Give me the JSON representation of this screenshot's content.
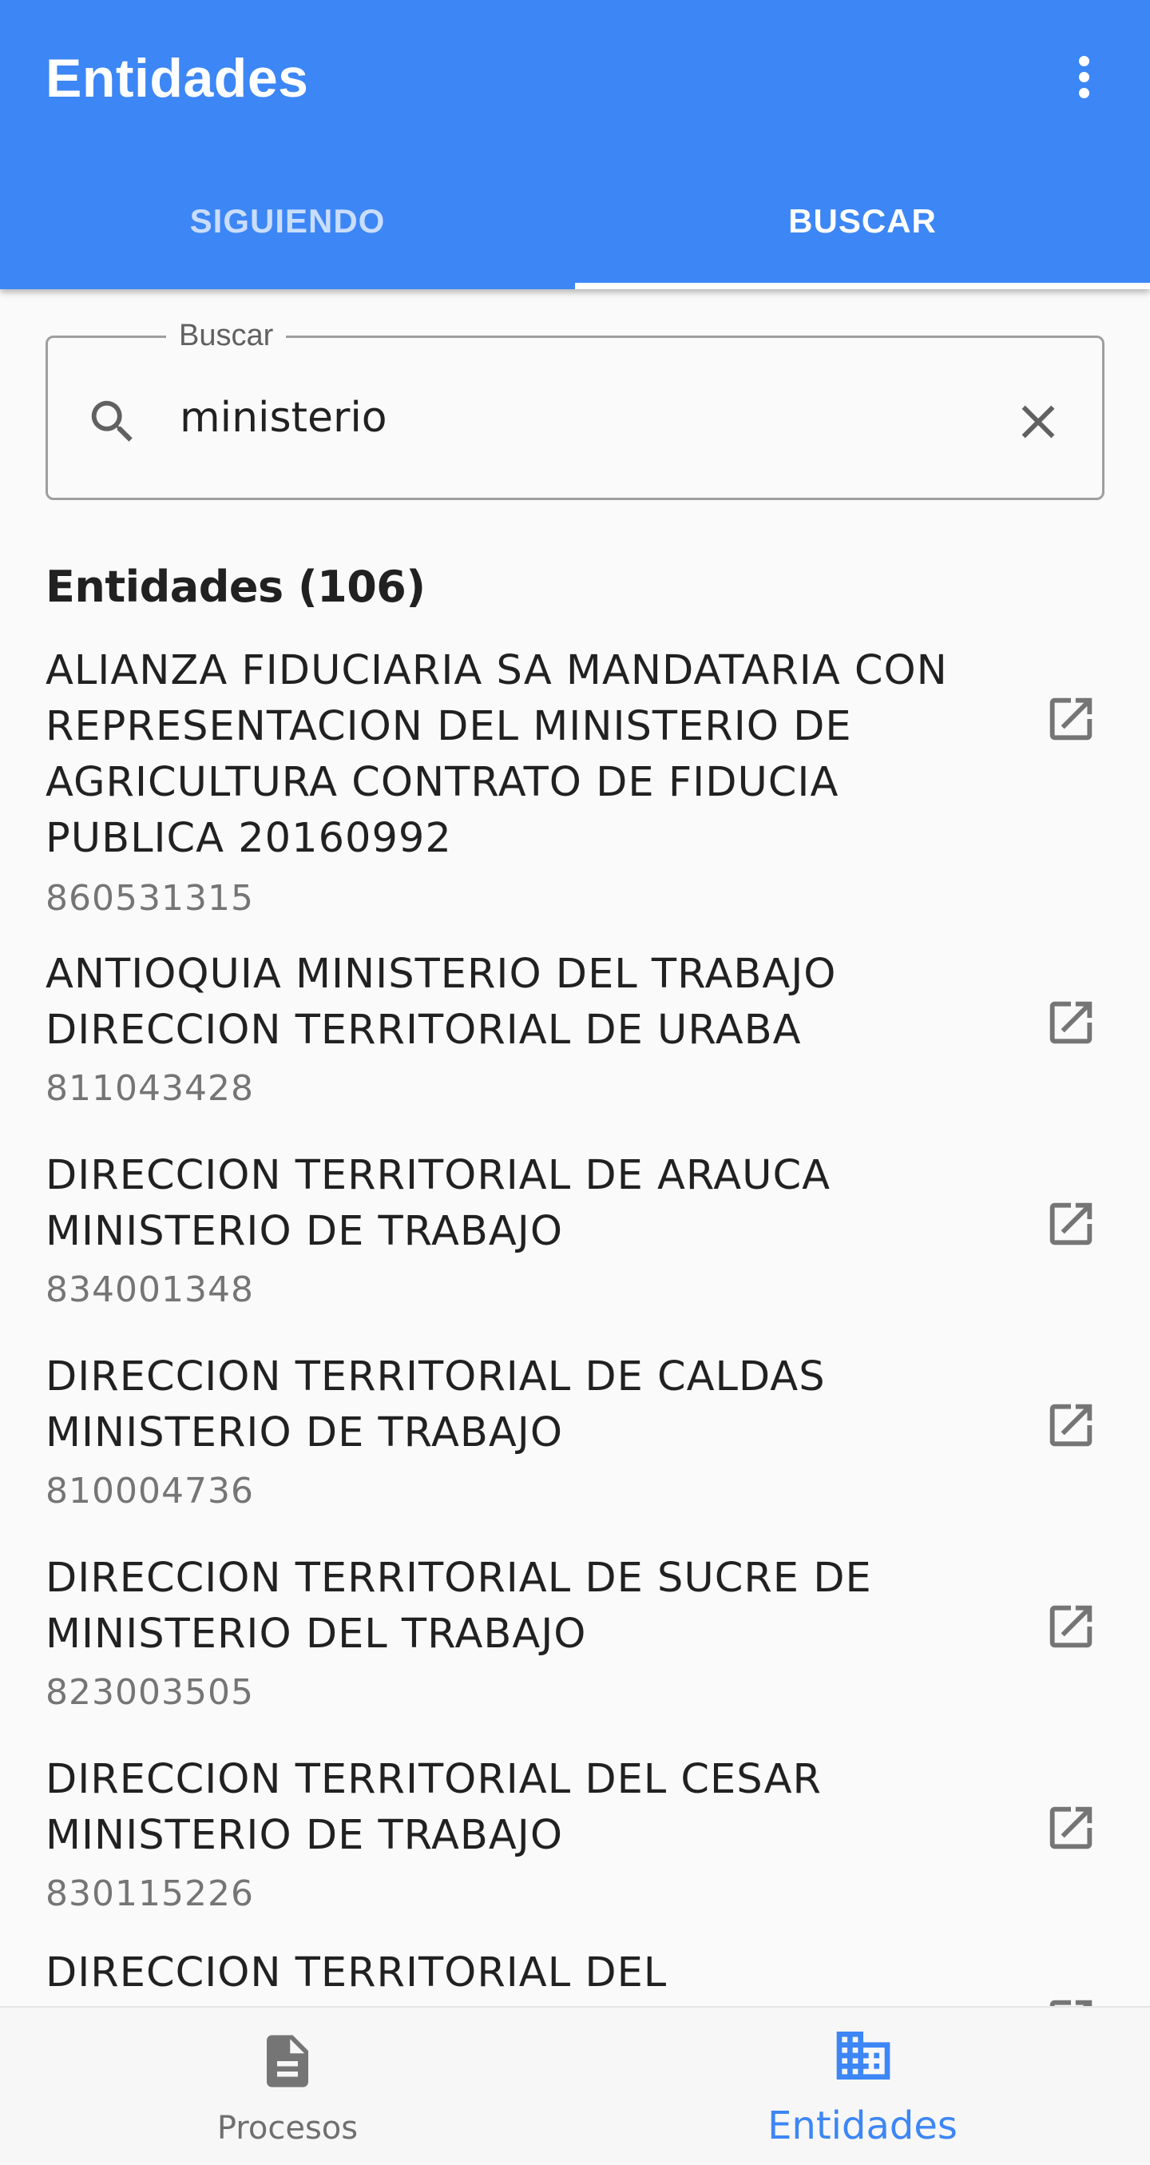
{
  "app_bar": {
    "title": "Entidades",
    "menu_icon": "more-vert-icon"
  },
  "tabs": [
    {
      "label": "SIGUIENDO",
      "selected": false
    },
    {
      "label": "BUSCAR",
      "selected": true
    }
  ],
  "search": {
    "label": "Buscar",
    "value": "ministerio",
    "search_icon": "search-icon",
    "clear_icon": "close-icon"
  },
  "results": {
    "header": "Entidades (106)",
    "items": [
      {
        "name": "ALIANZA FIDUCIARIA SA MANDATARIA CON REPRESENTACION DEL MINISTERIO DE AGRICULTURA CONTRATO DE FIDUCIA PUBLICA 20160992",
        "nit": "860531315"
      },
      {
        "name": "ANTIOQUIA MINISTERIO DEL TRABAJO DIRECCION TERRITORIAL DE URABA",
        "nit": "811043428"
      },
      {
        "name": "DIRECCION TERRITORIAL DE ARAUCA MINISTERIO DE TRABAJO",
        "nit": "834001348"
      },
      {
        "name": "DIRECCION TERRITORIAL DE CALDAS MINISTERIO DE TRABAJO",
        "nit": "810004736"
      },
      {
        "name": "DIRECCION TERRITORIAL DE SUCRE DE MINISTERIO DEL TRABAJO",
        "nit": "823003505"
      },
      {
        "name": "DIRECCION TERRITORIAL DEL CESAR MINISTERIO DE TRABAJO",
        "nit": "830115226"
      },
      {
        "name": "DIRECCION TERRITORIAL DEL",
        "nit": ""
      }
    ],
    "item_icon": "open-in-new-icon"
  },
  "bottom_nav": [
    {
      "label": "Procesos",
      "icon": "document-icon",
      "selected": false
    },
    {
      "label": "Entidades",
      "icon": "building-icon",
      "selected": true
    }
  ],
  "colors": {
    "primary": "#3d86f5",
    "background": "#fafafa",
    "text_primary": "#212121",
    "text_secondary": "#757575"
  }
}
